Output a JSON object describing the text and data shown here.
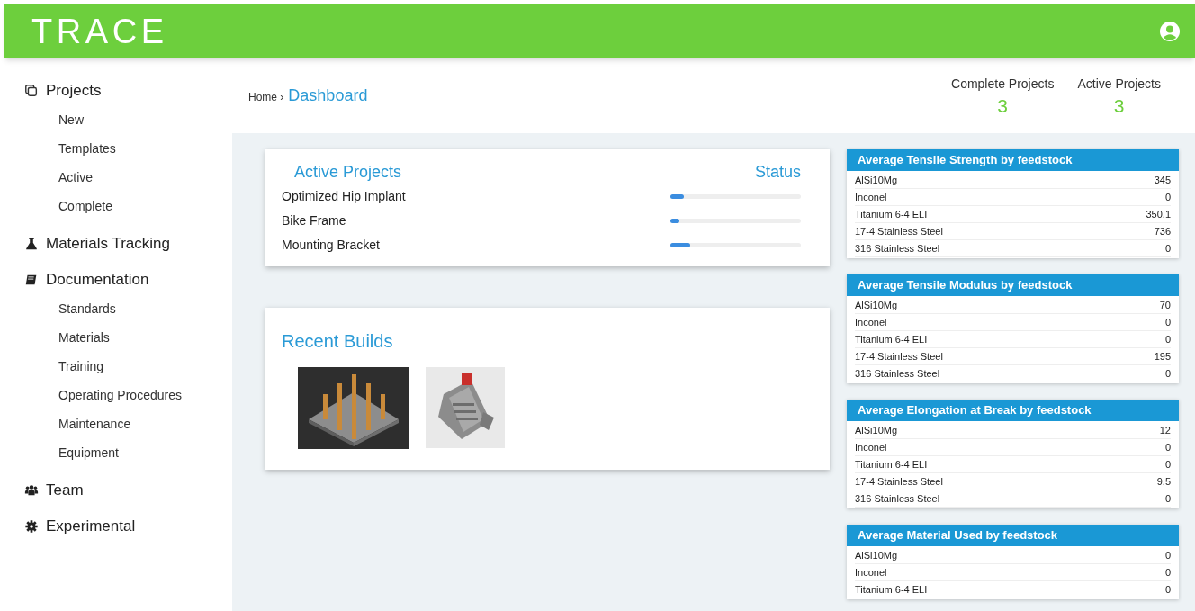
{
  "header": {
    "logo": "TRACE"
  },
  "sidebar": {
    "sections": [
      {
        "kind": "copy",
        "label": "Projects",
        "children": [
          {
            "label": "New"
          },
          {
            "label": "Templates"
          },
          {
            "label": "Active"
          },
          {
            "label": "Complete"
          }
        ]
      },
      {
        "kind": "flask",
        "label": "Materials Tracking"
      },
      {
        "kind": "book",
        "label": "Documentation",
        "children": [
          {
            "label": "Standards"
          },
          {
            "label": "Materials"
          },
          {
            "label": "Training"
          },
          {
            "label": "Operating Procedures"
          },
          {
            "label": "Maintenance"
          },
          {
            "label": "Equipment"
          }
        ]
      },
      {
        "kind": "team",
        "label": "Team"
      },
      {
        "kind": "gear",
        "label": "Experimental"
      }
    ]
  },
  "breadcrumb": {
    "parent": "Home ›",
    "current": "Dashboard"
  },
  "stats": [
    {
      "label": "Complete Projects",
      "value": "3"
    },
    {
      "label": "Active Projects",
      "value": "3"
    }
  ],
  "active_projects": {
    "title": "Active Projects",
    "status_heading": "Status",
    "projects": [
      {
        "name": "Optimized Hip Implant",
        "level": 0.1
      },
      {
        "name": "Bike Frame",
        "level": 0.07
      },
      {
        "name": "Mounting Bracket",
        "level": 0.15
      }
    ]
  },
  "recent_builds": {
    "title": "Recent Builds"
  },
  "tables": [
    {
      "title": "Average Tensile Strength by feedstock",
      "rows": [
        [
          "AlSi10Mg",
          "345"
        ],
        [
          "Inconel",
          "0"
        ],
        [
          "Titanium 6-4 ELI",
          "350.1"
        ],
        [
          "17-4 Stainless Steel",
          "736"
        ],
        [
          "316 Stainless Steel",
          "0"
        ]
      ]
    },
    {
      "title": "Average Tensile Modulus by feedstock",
      "rows": [
        [
          "AlSi10Mg",
          "70"
        ],
        [
          "Inconel",
          "0"
        ],
        [
          "Titanium 6-4 ELI",
          "0"
        ],
        [
          "17-4 Stainless Steel",
          "195"
        ],
        [
          "316 Stainless Steel",
          "0"
        ]
      ]
    },
    {
      "title": "Average Elongation at Break by feedstock",
      "rows": [
        [
          "AlSi10Mg",
          "12"
        ],
        [
          "Inconel",
          "0"
        ],
        [
          "Titanium 6-4 ELI",
          "0"
        ],
        [
          "17-4 Stainless Steel",
          "9.5"
        ],
        [
          "316 Stainless Steel",
          "0"
        ]
      ]
    },
    {
      "title": "Average Material Used by feedstock",
      "rows": [
        [
          "AlSi10Mg",
          "0"
        ],
        [
          "Inconel",
          "0"
        ],
        [
          "Titanium 6-4 ELI",
          "0"
        ]
      ]
    }
  ]
}
